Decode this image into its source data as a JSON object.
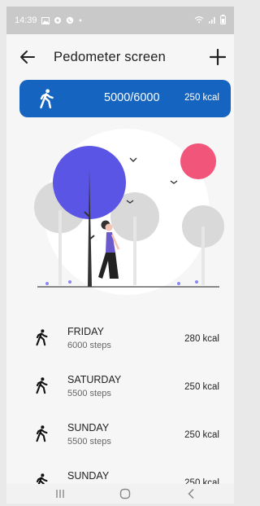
{
  "status_bar": {
    "time": "14:39",
    "icons": [
      "image-icon",
      "settings-icon",
      "whatsapp-icon",
      "dot-icon",
      "wifi-icon",
      "signal-icon",
      "battery-icon"
    ]
  },
  "app_bar": {
    "title": "Pedometer screen",
    "back_icon": "arrow-left-icon",
    "add_icon": "plus-icon"
  },
  "summary": {
    "steps": "5000/6000",
    "kcal": "250 kcal",
    "icon": "walking-icon",
    "color": "#1565c0"
  },
  "illustration": {
    "accent_colors": [
      "#5b55e6",
      "#f2557a"
    ]
  },
  "activity_list": [
    {
      "day": "FRIDAY",
      "steps": "6000 steps",
      "kcal": "280 kcal"
    },
    {
      "day": "SATURDAY",
      "steps": "5500 steps",
      "kcal": "250 kcal"
    },
    {
      "day": "SUNDAY",
      "steps": "5500 steps",
      "kcal": "250 kcal"
    },
    {
      "day": "SUNDAY",
      "steps": "",
      "kcal": "250 kcal"
    }
  ],
  "nav_bar": {
    "icons": [
      "recent-apps-icon",
      "home-icon",
      "back-icon"
    ]
  }
}
